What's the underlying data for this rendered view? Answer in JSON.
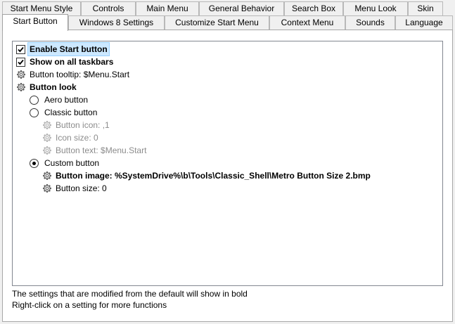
{
  "tabs_top": [
    {
      "label": "Start Menu Style"
    },
    {
      "label": "Controls"
    },
    {
      "label": "Main Menu"
    },
    {
      "label": "General Behavior"
    },
    {
      "label": "Search Box"
    },
    {
      "label": "Menu Look"
    },
    {
      "label": "Skin"
    }
  ],
  "tabs_bottom": [
    {
      "label": "Start Button",
      "selected": true
    },
    {
      "label": "Windows 8 Settings"
    },
    {
      "label": "Customize Start Menu"
    },
    {
      "label": "Context Menu"
    },
    {
      "label": "Sounds"
    },
    {
      "label": "Language"
    }
  ],
  "settings": {
    "enable_start_button": {
      "label": "Enable Start button",
      "checked": true
    },
    "show_on_all_taskbars": {
      "label": "Show on all taskbars",
      "checked": true
    },
    "button_tooltip": {
      "label": "Button tooltip: $Menu.Start"
    },
    "button_look": {
      "label": "Button look"
    },
    "aero_button": {
      "label": "Aero button",
      "selected": false
    },
    "classic_button": {
      "label": "Classic button",
      "selected": false
    },
    "button_icon": {
      "label": "Button icon: ,1"
    },
    "icon_size": {
      "label": "Icon size: 0"
    },
    "button_text": {
      "label": "Button text: $Menu.Start"
    },
    "custom_button": {
      "label": "Custom button",
      "selected": true
    },
    "button_image": {
      "label": "Button image: %SystemDrive%\\b\\Tools\\Classic_Shell\\Metro Button Size 2.bmp"
    },
    "button_size": {
      "label": "Button size: 0"
    }
  },
  "footer": {
    "line1": "The settings that are modified from the default will show in bold",
    "line2": "Right-click on a setting for more functions"
  },
  "icons": {
    "setting": "gear-icon",
    "check": "checkmark-icon"
  }
}
